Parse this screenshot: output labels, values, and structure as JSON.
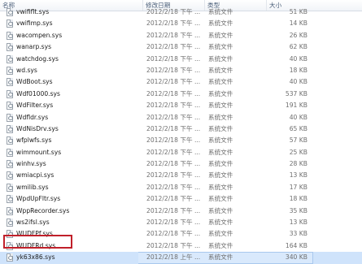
{
  "columns": {
    "name": "名称",
    "date": "修改日期",
    "type": "类型",
    "size": "大小"
  },
  "files": [
    {
      "name": "vwifimp.sys",
      "date": "2012/2/18 下午 ...",
      "type": "系统文件",
      "size": "14 KB"
    },
    {
      "name": "wacompen.sys",
      "date": "2012/2/18 下午 ...",
      "type": "系统文件",
      "size": "26 KB"
    },
    {
      "name": "wanarp.sys",
      "date": "2012/2/18 下午 ...",
      "type": "系统文件",
      "size": "62 KB"
    },
    {
      "name": "watchdog.sys",
      "date": "2012/2/18 下午 ...",
      "type": "系统文件",
      "size": "40 KB"
    },
    {
      "name": "wd.sys",
      "date": "2012/2/18 下午 ...",
      "type": "系统文件",
      "size": "18 KB"
    },
    {
      "name": "WdBoot.sys",
      "date": "2012/2/18 下午 ...",
      "type": "系统文件",
      "size": "40 KB"
    },
    {
      "name": "Wdf01000.sys",
      "date": "2012/2/18 下午 ...",
      "type": "系统文件",
      "size": "537 KB"
    },
    {
      "name": "WdFilter.sys",
      "date": "2012/2/18 下午 ...",
      "type": "系统文件",
      "size": "191 KB"
    },
    {
      "name": "Wdfldr.sys",
      "date": "2012/2/18 下午 ...",
      "type": "系统文件",
      "size": "40 KB"
    },
    {
      "name": "WdNisDrv.sys",
      "date": "2012/2/18 下午 ...",
      "type": "系统文件",
      "size": "65 KB"
    },
    {
      "name": "wfplwfs.sys",
      "date": "2012/2/18 下午 ...",
      "type": "系统文件",
      "size": "57 KB"
    },
    {
      "name": "wimmount.sys",
      "date": "2012/2/18 下午 ...",
      "type": "系统文件",
      "size": "25 KB"
    },
    {
      "name": "winhv.sys",
      "date": "2012/2/18 下午 ...",
      "type": "系统文件",
      "size": "28 KB"
    },
    {
      "name": "wmiacpi.sys",
      "date": "2012/2/18 下午 ...",
      "type": "系统文件",
      "size": "13 KB"
    },
    {
      "name": "wmilib.sys",
      "date": "2012/2/18 下午 ...",
      "type": "系统文件",
      "size": "17 KB"
    },
    {
      "name": "WpdUpFltr.sys",
      "date": "2012/2/18 下午 ...",
      "type": "系统文件",
      "size": "18 KB"
    },
    {
      "name": "WppRecorder.sys",
      "date": "2012/2/18 下午 ...",
      "type": "系统文件",
      "size": "35 KB"
    },
    {
      "name": "ws2ifsl.sys",
      "date": "2012/2/18 下午 ...",
      "type": "系统文件",
      "size": "13 KB"
    },
    {
      "name": "WUDFPf.sys",
      "date": "2012/2/18 下午 ...",
      "type": "系统文件",
      "size": "33 KB"
    },
    {
      "name": "WUDFRd.sys",
      "date": "2012/2/18 下午 ...",
      "type": "系统文件",
      "size": "164 KB"
    },
    {
      "name": "yk63x86.sys",
      "date": "2012/2/18 上午 ...",
      "type": "系统文件",
      "size": "340 KB"
    }
  ],
  "partial_row": {
    "name": "vwififlt.sys",
    "date": "2012/2/18 下午 ...",
    "type": "系统文件",
    "size": "51 KB"
  },
  "selected_index": 20,
  "colors": {
    "selection": "#cfe3fb",
    "highlight_box": "#c0202a",
    "header_text": "#4c607a"
  },
  "icons": {
    "file": "system-file-icon"
  }
}
